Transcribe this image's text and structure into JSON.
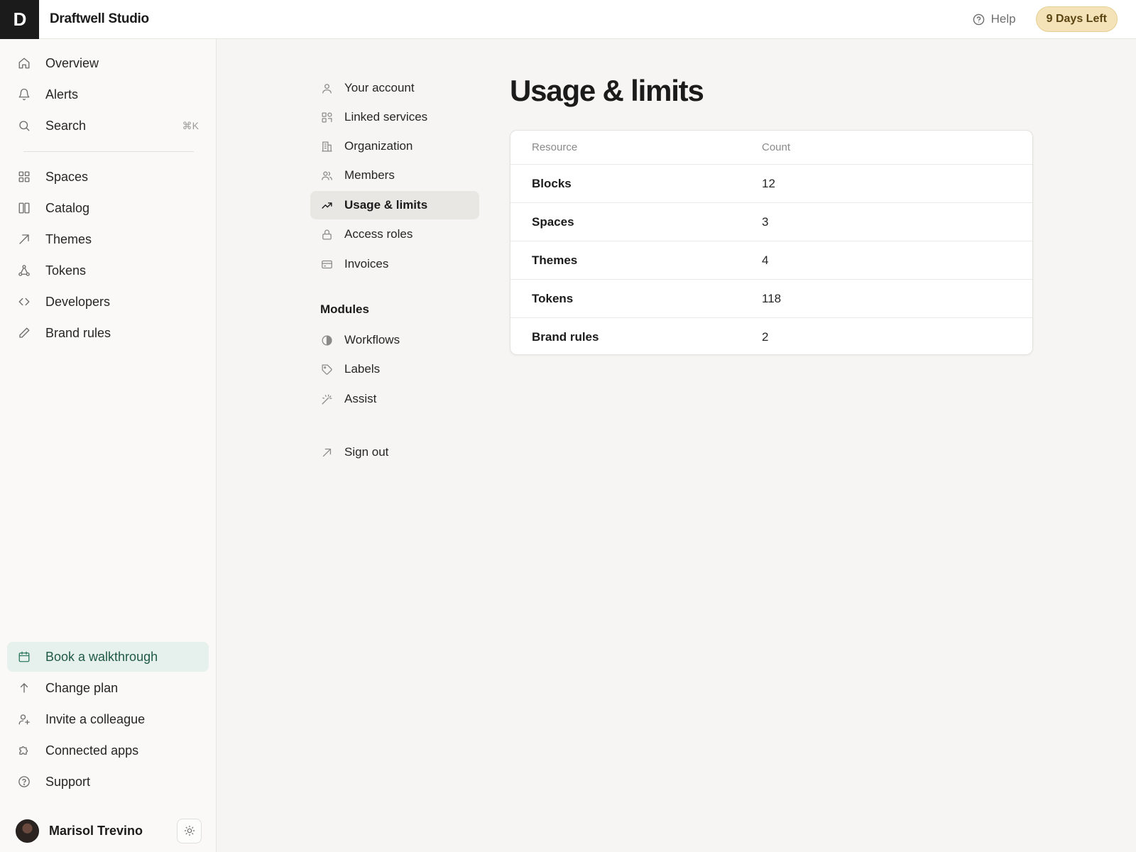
{
  "app": {
    "logo_letter": "D",
    "name": "Draftwell Studio",
    "help_label": "Help",
    "trial_badge": "9 Days Left"
  },
  "sidebar": {
    "primary": [
      {
        "label": "Overview",
        "icon": "home-icon"
      },
      {
        "label": "Alerts",
        "icon": "bell-icon"
      },
      {
        "label": "Search",
        "icon": "search-icon",
        "shortcut": "⌘K"
      }
    ],
    "secondary": [
      {
        "label": "Spaces",
        "icon": "grid-icon"
      },
      {
        "label": "Catalog",
        "icon": "columns-icon"
      },
      {
        "label": "Themes",
        "icon": "arrow-up-right-icon"
      },
      {
        "label": "Tokens",
        "icon": "nodes-icon"
      },
      {
        "label": "Developers",
        "icon": "code-icon"
      },
      {
        "label": "Brand rules",
        "icon": "pencil-icon"
      }
    ],
    "bottom": [
      {
        "label": "Book a walkthrough",
        "icon": "calendar-icon"
      },
      {
        "label": "Change plan",
        "icon": "arrow-up-icon"
      },
      {
        "label": "Invite a colleague",
        "icon": "user-plus-icon"
      },
      {
        "label": "Connected apps",
        "icon": "puzzle-icon"
      },
      {
        "label": "Support",
        "icon": "help-circle-icon"
      }
    ],
    "user": {
      "name": "Marisol Trevino"
    }
  },
  "settings_nav": {
    "items": [
      {
        "label": "Your account",
        "icon": "user-icon"
      },
      {
        "label": "Linked services",
        "icon": "apps-icon"
      },
      {
        "label": "Organization",
        "icon": "building-icon"
      },
      {
        "label": "Members",
        "icon": "users-icon"
      },
      {
        "label": "Usage & limits",
        "icon": "trending-up-icon",
        "active": true
      },
      {
        "label": "Access roles",
        "icon": "lock-icon"
      },
      {
        "label": "Invoices",
        "icon": "credit-card-icon"
      }
    ],
    "modules_heading": "Modules",
    "modules": [
      {
        "label": "Workflows",
        "icon": "half-circle-icon"
      },
      {
        "label": "Labels",
        "icon": "tag-icon"
      },
      {
        "label": "Assist",
        "icon": "magic-wand-icon"
      }
    ],
    "sign_out": {
      "label": "Sign out",
      "icon": "arrow-up-right-icon"
    }
  },
  "main": {
    "title": "Usage & limits",
    "table": {
      "columns": [
        "Resource",
        "Count"
      ],
      "rows": [
        {
          "resource": "Blocks",
          "count": "12"
        },
        {
          "resource": "Spaces",
          "count": "3"
        },
        {
          "resource": "Themes",
          "count": "4"
        },
        {
          "resource": "Tokens",
          "count": "118"
        },
        {
          "resource": "Brand rules",
          "count": "2"
        }
      ]
    }
  },
  "colors": {
    "accent_highlight_bg": "#e6f0ec",
    "accent_highlight_text": "#1f5a47",
    "trial_badge_bg": "#f4e3b8"
  }
}
